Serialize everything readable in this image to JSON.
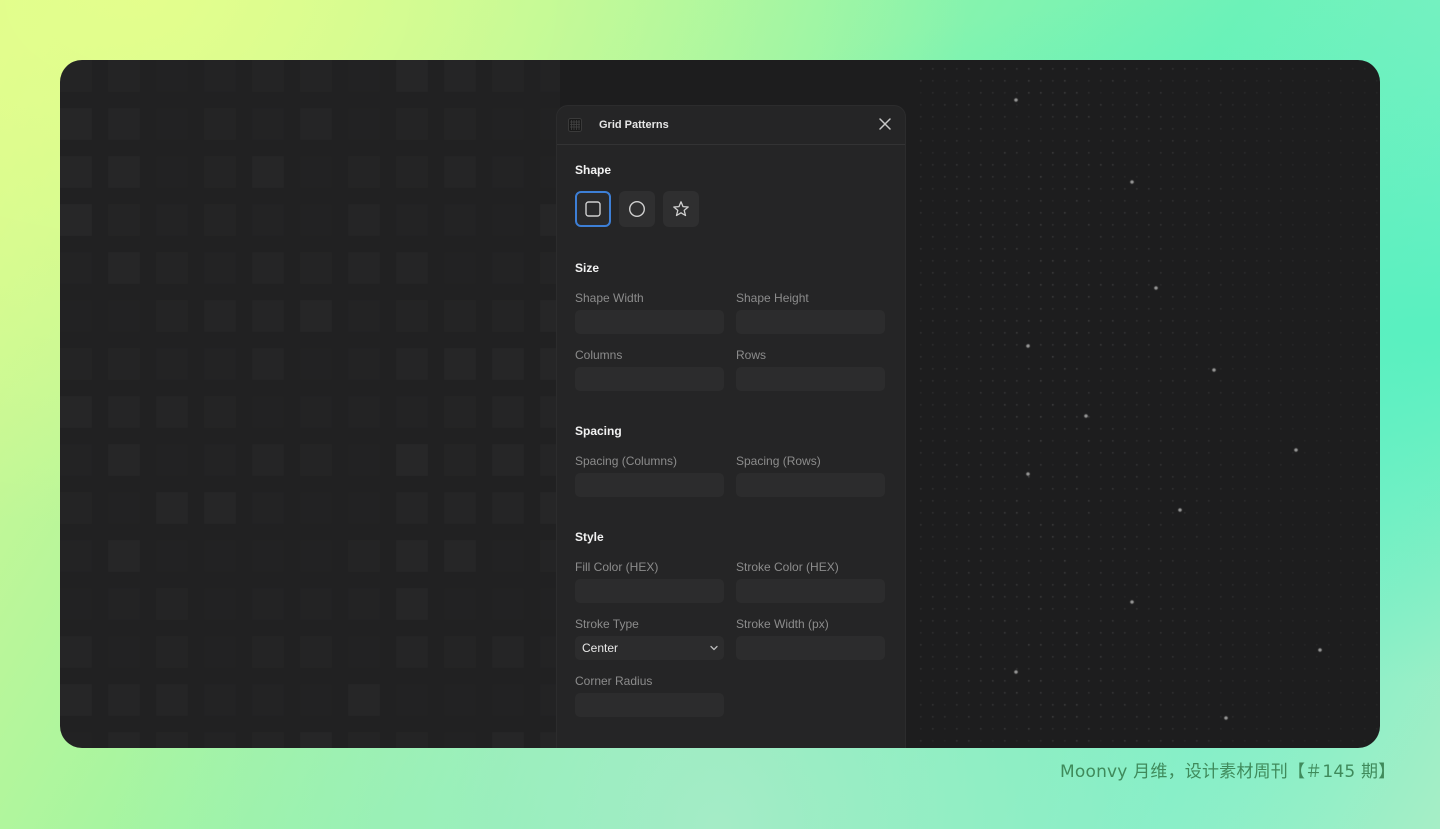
{
  "panel": {
    "title": "Grid Patterns",
    "header_icon": "grid-icon",
    "close_icon": "close-icon"
  },
  "sections": {
    "shape": {
      "title": "Shape",
      "options": [
        {
          "name": "square",
          "icon": "square-icon",
          "selected": true
        },
        {
          "name": "circle",
          "icon": "circle-icon",
          "selected": false
        },
        {
          "name": "star",
          "icon": "star-icon",
          "selected": false
        }
      ]
    },
    "size": {
      "title": "Size",
      "shape_width": {
        "label": "Shape Width",
        "value": ""
      },
      "shape_height": {
        "label": "Shape Height",
        "value": ""
      },
      "columns": {
        "label": "Columns",
        "value": ""
      },
      "rows": {
        "label": "Rows",
        "value": ""
      }
    },
    "spacing": {
      "title": "Spacing",
      "spacing_columns": {
        "label": "Spacing (Columns)",
        "value": ""
      },
      "spacing_rows": {
        "label": "Spacing (Rows)",
        "value": ""
      }
    },
    "style": {
      "title": "Style",
      "fill_color": {
        "label": "Fill Color (HEX)",
        "value": ""
      },
      "stroke_color": {
        "label": "Stroke Color (HEX)",
        "value": ""
      },
      "stroke_type": {
        "label": "Stroke Type",
        "value": "Center"
      },
      "stroke_width": {
        "label": "Stroke Width (px)",
        "value": ""
      },
      "corner_radius": {
        "label": "Corner Radius",
        "value": ""
      }
    }
  },
  "colors": {
    "accent": "#3d7fd6",
    "panel_bg": "#252526",
    "canvas_bg": "#1d1d1e"
  },
  "caption": "Moonvy 月维，设计素材周刊【＃145 期】"
}
